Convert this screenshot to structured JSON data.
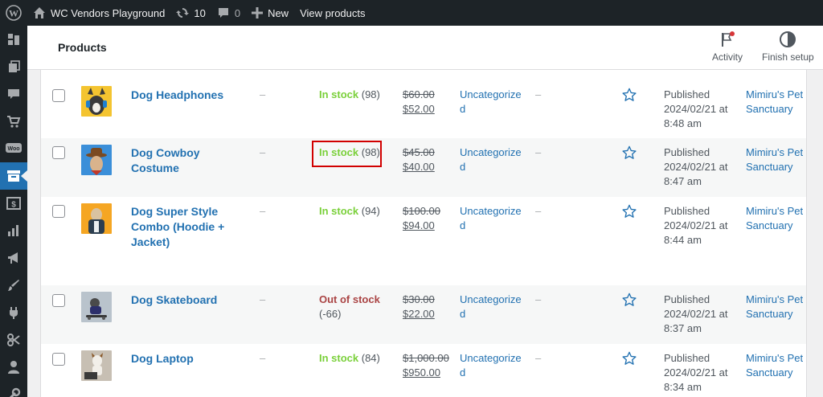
{
  "adminbar": {
    "site_name": "WC Vendors Playground",
    "updates_count": "10",
    "comments_count": "0",
    "new_label": "New",
    "view_label": "View products"
  },
  "header": {
    "title": "Products",
    "activity_label": "Activity",
    "finish_setup_label": "Finish setup"
  },
  "sidebar": {
    "items": [
      "dashboard",
      "posts",
      "media",
      "pages",
      "comments",
      "woocommerce",
      "products",
      "payments",
      "analytics",
      "marketing",
      "appearance",
      "plugins",
      "tools",
      "users",
      "settings"
    ]
  },
  "products": [
    {
      "name": "Dog Headphones",
      "sku": "–",
      "stock_status": "In stock",
      "stock_count": "(98)",
      "in_stock": true,
      "regular_price": "$60.00",
      "sale_price": "$52.00",
      "category": "Uncategorized",
      "tags": "–",
      "date_status": "Published",
      "date": "2024/02/21 at 8:48 am",
      "vendor": "Mimiru's Pet Sanctuary",
      "thumb_color": "#f4c430"
    },
    {
      "name": "Dog Cowboy Costume",
      "sku": "–",
      "stock_status": "In stock",
      "stock_count": "(98)",
      "in_stock": true,
      "regular_price": "$45.00",
      "sale_price": "$40.00",
      "category": "Uncategorized",
      "tags": "–",
      "date_status": "Published",
      "date": "2024/02/21 at 8:47 am",
      "vendor": "Mimiru's Pet Sanctuary",
      "thumb_color": "#3b8fd9"
    },
    {
      "name": "Dog Super Style Combo (Hoodie + Jacket)",
      "sku": "–",
      "stock_status": "In stock",
      "stock_count": "(94)",
      "in_stock": true,
      "regular_price": "$100.00",
      "sale_price": "$94.00",
      "category": "Uncategorized",
      "tags": "–",
      "date_status": "Published",
      "date": "2024/02/21 at 8:44 am",
      "vendor": "Mimiru's Pet Sanctuary",
      "thumb_color": "#f5a623"
    },
    {
      "name": "Dog Skateboard",
      "sku": "–",
      "stock_status": "Out of stock",
      "stock_count": "(-66)",
      "in_stock": false,
      "regular_price": "$30.00",
      "sale_price": "$22.00",
      "category": "Uncategorized",
      "tags": "–",
      "date_status": "Published",
      "date": "2024/02/21 at 8:37 am",
      "vendor": "Mimiru's Pet Sanctuary",
      "thumb_color": "#b9c3cc"
    },
    {
      "name": "Dog Laptop",
      "sku": "–",
      "stock_status": "In stock",
      "stock_count": "(84)",
      "in_stock": true,
      "regular_price": "$1,000.00",
      "sale_price": "$950.00",
      "category": "Uncategorized",
      "tags": "–",
      "date_status": "Published",
      "date": "2024/02/21 at 8:34 am",
      "vendor": "Mimiru's Pet Sanctuary",
      "thumb_color": "#c7bfb3"
    }
  ],
  "colors": {
    "accent": "#2271b1",
    "in_stock": "#7ad03a",
    "out_of_stock": "#aa4444",
    "highlight": "#d10000"
  }
}
